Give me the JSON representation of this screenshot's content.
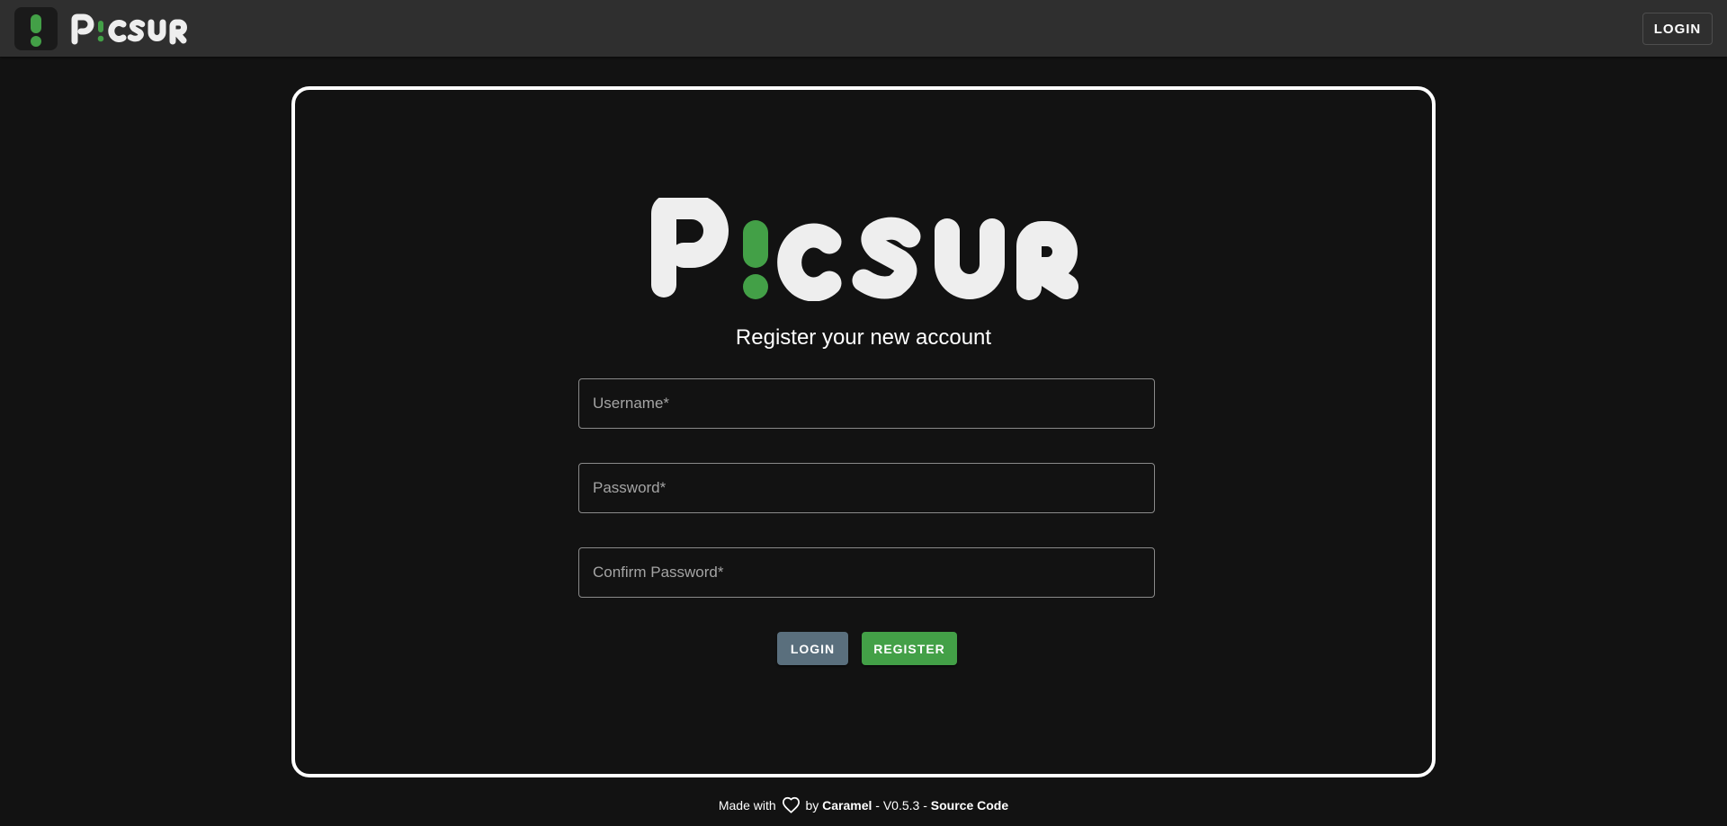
{
  "header": {
    "brand": "PICSUR",
    "login_label": "LOGIN"
  },
  "card": {
    "logo_text": "PICSUR",
    "subtitle": "Register your new account",
    "fields": {
      "username_placeholder": "Username*",
      "password_placeholder": "Password*",
      "confirm_placeholder": "Confirm Password*"
    },
    "login_button": "LOGIN",
    "register_button": "REGISTER"
  },
  "footer": {
    "made_with": "Made with",
    "heart_icon": "heart-outline-icon",
    "by": "by",
    "author": "Caramel",
    "separator1": "-",
    "version": "V0.5.3",
    "separator2": "-",
    "source_link": "Source Code"
  },
  "colors": {
    "accent_green": "#43a047",
    "login_button_gray": "#5a6f7d",
    "topbar": "#2f2f2f",
    "background": "#121212"
  }
}
